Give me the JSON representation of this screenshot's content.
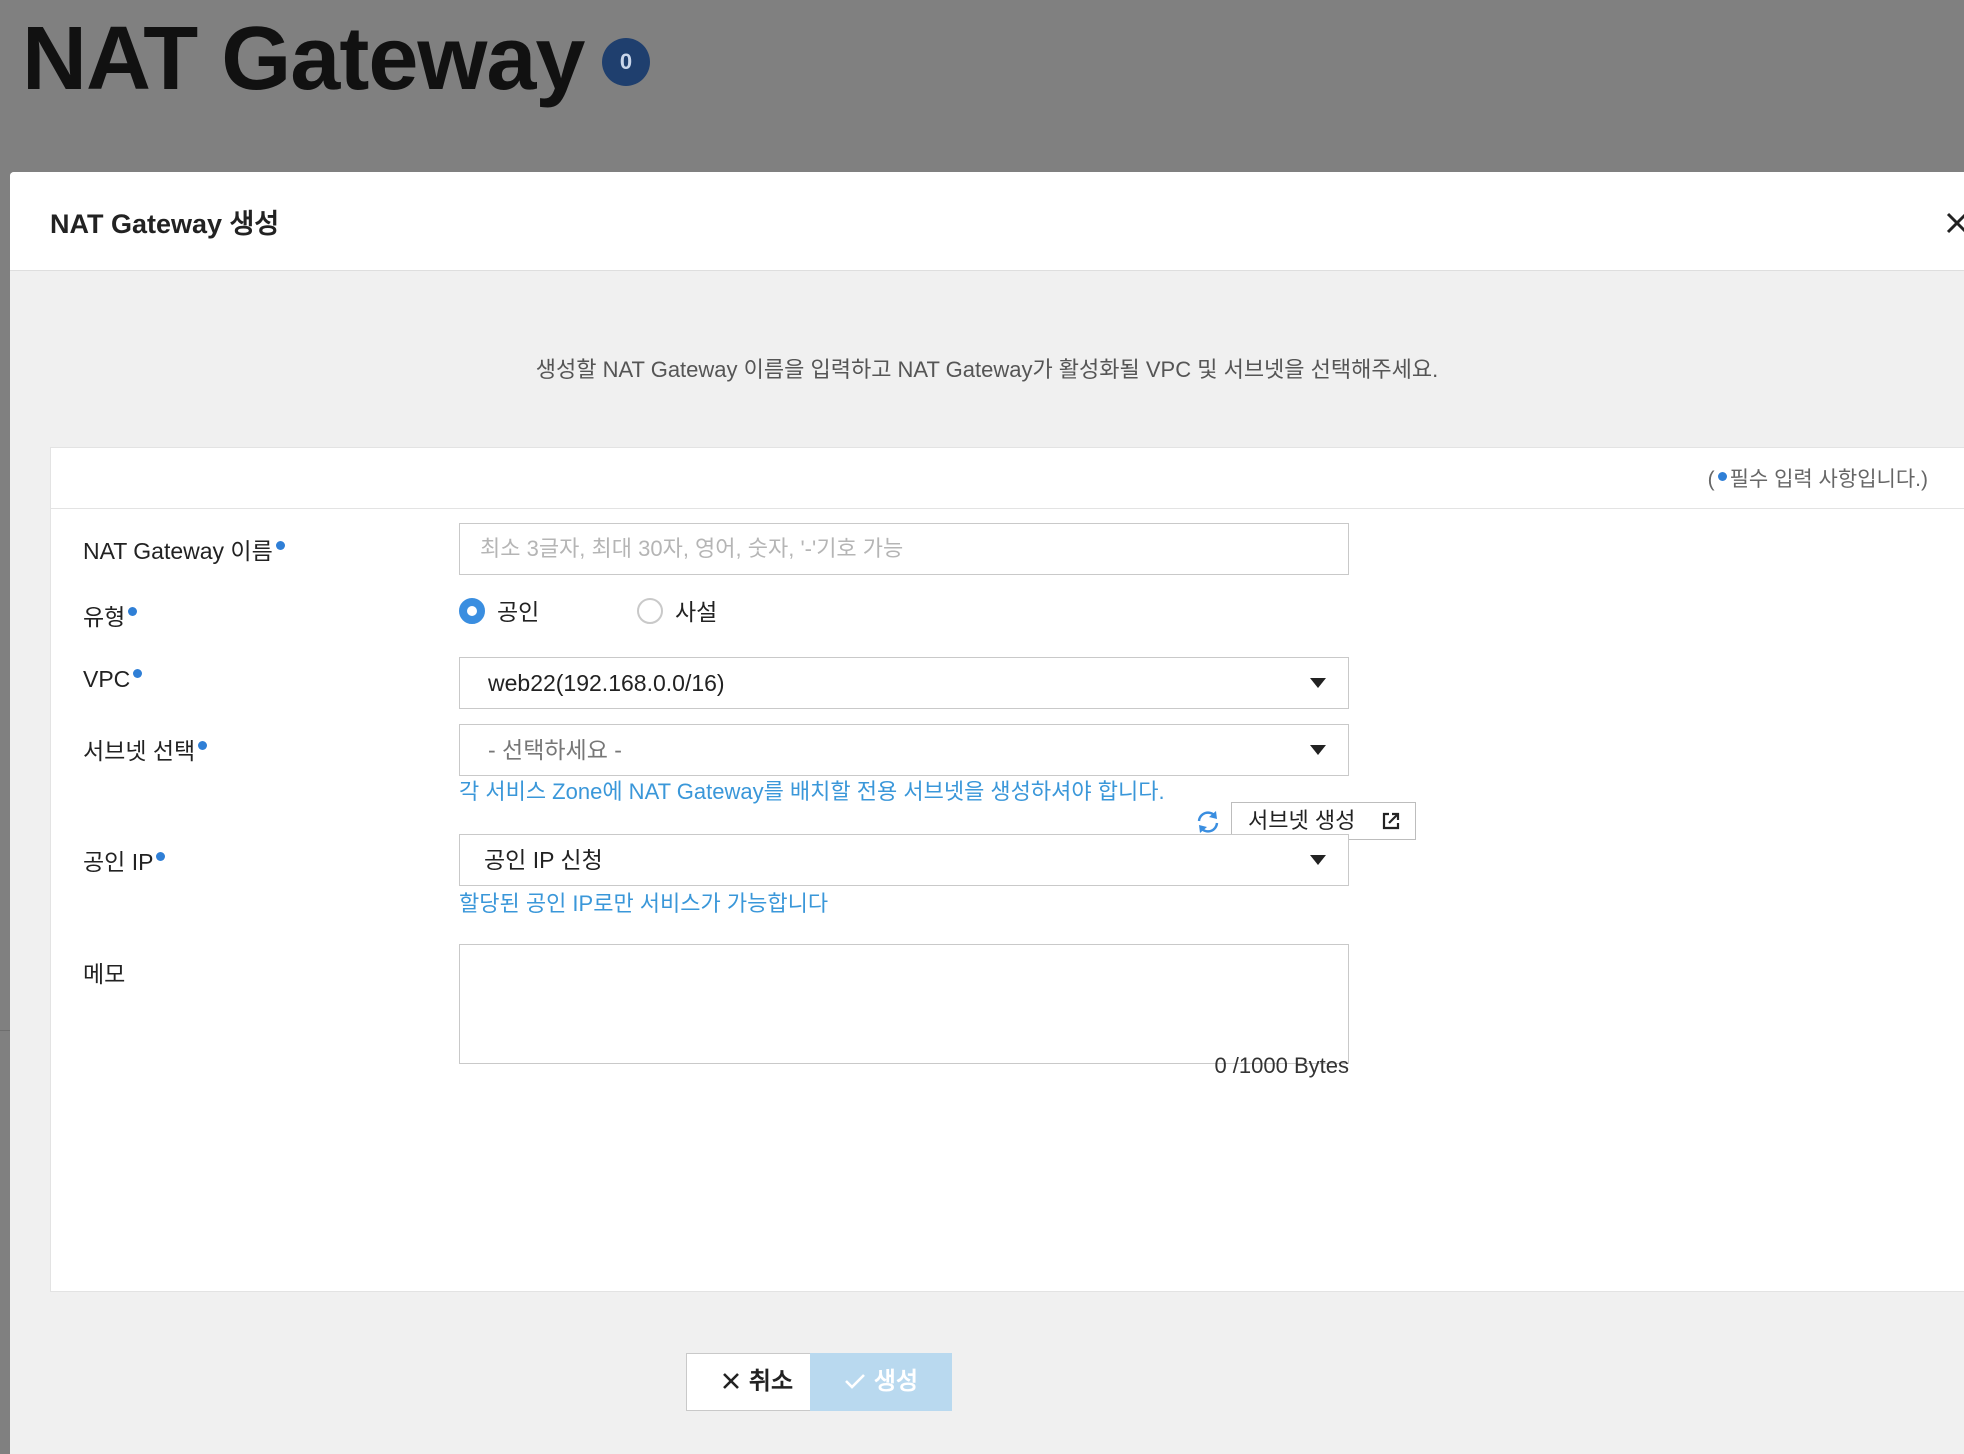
{
  "page": {
    "title": "NAT Gateway",
    "count": "0"
  },
  "modal": {
    "title": "NAT Gateway 생성",
    "intro": "생성할 NAT Gateway 이름을 입력하고 NAT Gateway가 활성화될 VPC 및 서브넷을 선택해주세요.",
    "required_note_open": "(",
    "required_note_text": "필수 입력 사항입니다.)",
    "fields": {
      "name": {
        "label": "NAT Gateway 이름",
        "placeholder": "최소 3글자, 최대 30자, 영어, 숫자, '-'기호 가능",
        "value": ""
      },
      "type": {
        "label": "유형",
        "options": [
          "공인",
          "사설"
        ],
        "selected": "공인"
      },
      "vpc": {
        "label": "VPC",
        "value": "web22(192.168.0.0/16)"
      },
      "subnet": {
        "label": "서브넷 선택",
        "value": "- 선택하세요 -",
        "create_button": "서브넷 생성",
        "help": "각 서비스 Zone에 NAT Gateway를 배치할 전용 서브넷을 생성하셔야 합니다."
      },
      "public_ip": {
        "label": "공인 IP",
        "value": "공인 IP 신청",
        "help": "할당된 공인 IP로만 서비스가 가능합니다"
      },
      "memo": {
        "label": "메모",
        "value": "",
        "counter": "0 /1000 Bytes"
      }
    },
    "buttons": {
      "cancel": "취소",
      "create": "생성"
    }
  },
  "colors": {
    "accent": "#3a8ee0",
    "help_text": "#3a97d9",
    "required_dot": "#2f7fd6",
    "badge": "#1f3f6e",
    "create_disabled": "#b9d9ef"
  },
  "icons": [
    "close-icon",
    "caret-down-icon",
    "refresh-icon",
    "external-link-icon",
    "x-icon",
    "check-icon"
  ]
}
